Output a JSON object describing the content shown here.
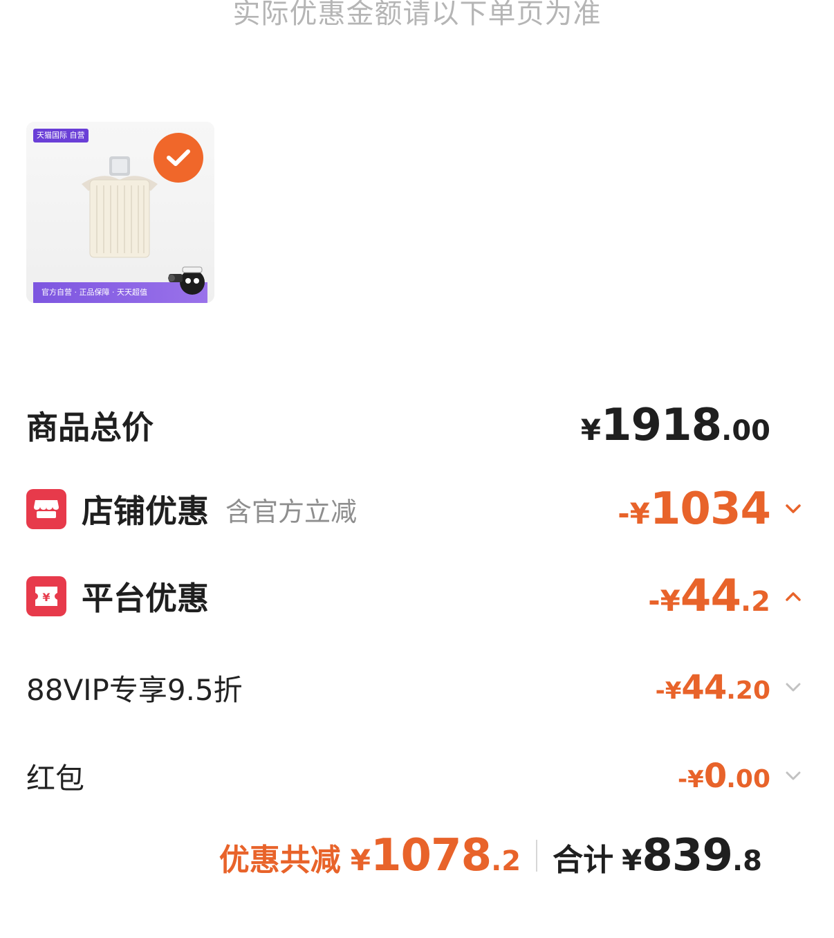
{
  "notice": "实际优惠金额请以下单页为准",
  "product": {
    "store_tag": "天猫国际 自营",
    "guarantee_text": "官方自营 · 正品保障 · 天天超值",
    "selected_icon": "check-icon",
    "accent_color": "#f0672a"
  },
  "rows": {
    "total": {
      "label": "商品总价",
      "currency": "¥",
      "int": "1918",
      "dec": ".00"
    },
    "store": {
      "icon": "store-icon",
      "label": "店铺优惠",
      "sub": "含官方立减",
      "prefix": "-¥",
      "int": "1034",
      "dec": ""
    },
    "platform": {
      "icon": "yen-coupon-icon",
      "label": "平台优惠",
      "prefix": "-¥",
      "int": "44",
      "dec": ".2"
    },
    "vip": {
      "label": "88VIP专享9.5折",
      "prefix": "-¥",
      "int": "44",
      "dec": ".20"
    },
    "redpacket": {
      "label": "红包",
      "prefix": "-¥",
      "int": "0",
      "dec": ".00"
    }
  },
  "summary": {
    "save_label": "优惠共减",
    "save_currency": "¥",
    "save_int": "1078",
    "save_dec": ".2",
    "total_label": "合计",
    "total_currency": "¥",
    "total_int": "839",
    "total_dec": ".8"
  },
  "colors": {
    "orange": "#e8632a",
    "icon_red": "#e73a4b",
    "tmall_purple": "#6a3fd7"
  }
}
